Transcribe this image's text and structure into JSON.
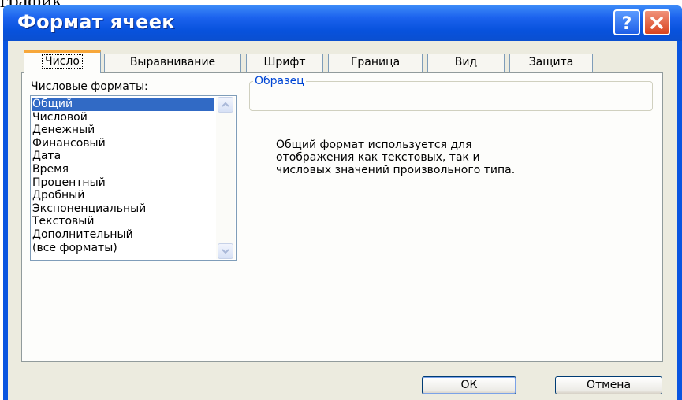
{
  "background_text": "график",
  "window": {
    "title": "Формат ячеек",
    "help_icon": "question-mark",
    "close_icon": "x-mark"
  },
  "tabs": [
    {
      "label": "Число",
      "active": true
    },
    {
      "label": "Выравнивание",
      "active": false
    },
    {
      "label": "Шрифт",
      "active": false
    },
    {
      "label": "Граница",
      "active": false
    },
    {
      "label": "Вид",
      "active": false
    },
    {
      "label": "Защита",
      "active": false
    }
  ],
  "number_tab": {
    "formats_label_underlined": "Ч",
    "formats_label_rest": "исловые форматы:",
    "formats": [
      "Общий",
      "Числовой",
      "Денежный",
      "Финансовый",
      "Дата",
      "Время",
      "Процентный",
      "Дробный",
      "Экспоненциальный",
      "Текстовый",
      "Дополнительный",
      "(все форматы)"
    ],
    "selected_format": "Общий",
    "sample_label": "Образец",
    "sample_value": "",
    "description": "Общий формат используется для\nотображения как текстовых, так и\nчисловых значений произвольного типа."
  },
  "buttons": {
    "ok": "ОК",
    "cancel": "Отмена"
  },
  "colors": {
    "titlebar": "#0a55e0",
    "dialog_face": "#ecebdf",
    "selection": "#316ac5",
    "active_tab_accent": "#f7a73a",
    "close_button": "#d9441f",
    "sample_label": "#0046d5"
  }
}
